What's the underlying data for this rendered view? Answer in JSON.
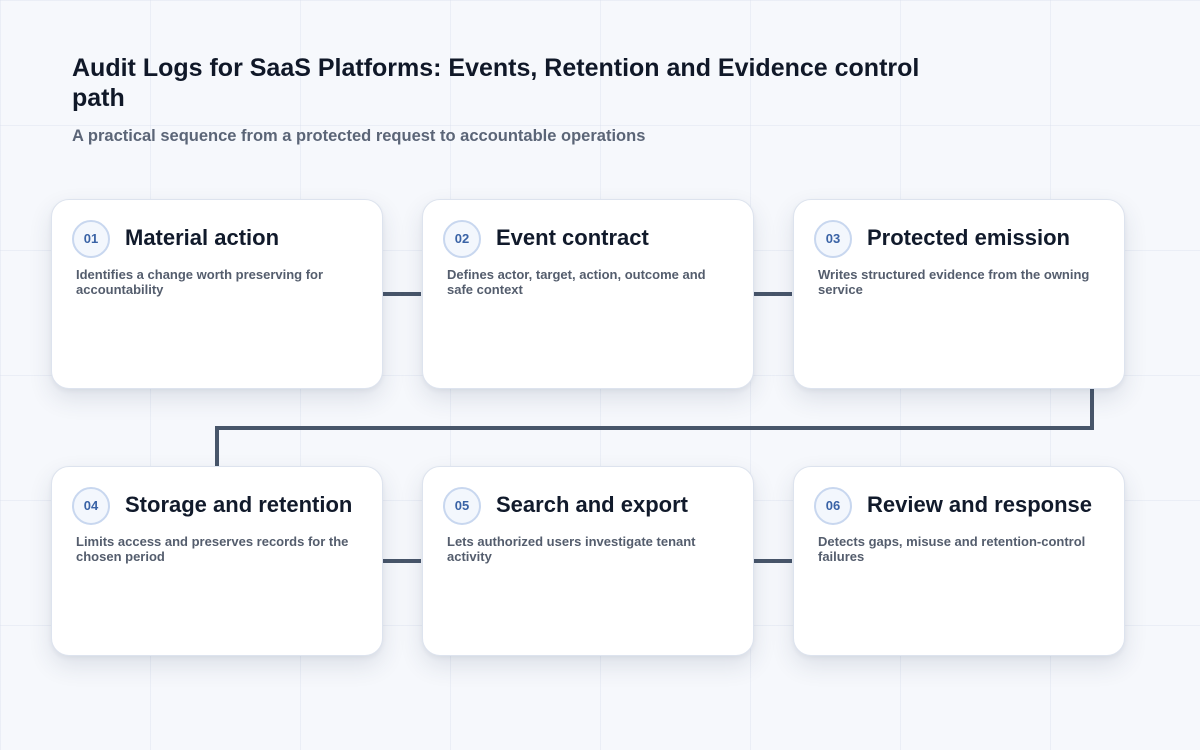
{
  "title": "Audit Logs for SaaS Platforms: Events, Retention and Evidence control path",
  "subtitle": "A practical sequence from a protected request to accountable operations",
  "colors": {
    "connector": "#48566a",
    "badge_text": "#3a63a6",
    "badge_border": "#c8d7ef"
  },
  "steps": [
    {
      "number": "01",
      "title": "Material action",
      "description": "Identifies a change worth preserving for accountability"
    },
    {
      "number": "02",
      "title": "Event contract",
      "description": "Defines actor, target, action, outcome and safe context"
    },
    {
      "number": "03",
      "title": "Protected emission",
      "description": "Writes structured evidence from the owning service"
    },
    {
      "number": "04",
      "title": "Storage and retention",
      "description": "Limits access and preserves records for the chosen period"
    },
    {
      "number": "05",
      "title": "Search and export",
      "description": "Lets authorized users investigate tenant activity"
    },
    {
      "number": "06",
      "title": "Review and response",
      "description": "Detects gaps, misuse and retention-control failures"
    }
  ]
}
